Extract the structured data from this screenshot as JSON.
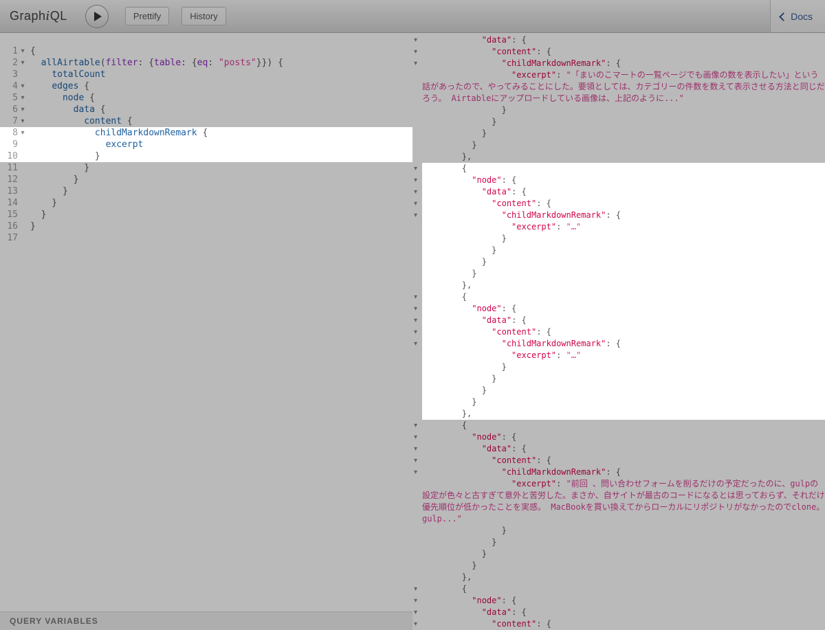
{
  "topbar": {
    "logo": {
      "part1": "Graph",
      "part2": "i",
      "part3": "QL"
    },
    "prettify_label": "Prettify",
    "history_label": "History",
    "docs_label": "Docs"
  },
  "icons": {
    "execute_icon": "play-triangle",
    "fold_glyph": "▾",
    "docs_chevron_icon": "chevron-left"
  },
  "colors": {
    "docs_accent": "#3B5998",
    "field_name": "#1F61A0",
    "argument_name": "#8B2BB9",
    "string_value": "#D64292",
    "result_key": "#D2054E",
    "punctuation": "#555555",
    "dim_overlay": "rgba(0,0,0,0.27)"
  },
  "variables": {
    "title": "QUERY VARIABLES"
  },
  "editor": {
    "highlight": {
      "from": 8,
      "to": 10
    },
    "lines": [
      {
        "n": 1,
        "fold": true,
        "toks": [
          [
            "p",
            "{"
          ]
        ]
      },
      {
        "n": 2,
        "fold": true,
        "toks": [
          [
            "p",
            "  "
          ],
          [
            "prop",
            "allAirtable"
          ],
          [
            "p",
            "("
          ],
          [
            "attr",
            "filter"
          ],
          [
            "p",
            ": {"
          ],
          [
            "attr",
            "table"
          ],
          [
            "p",
            ": {"
          ],
          [
            "attr",
            "eq"
          ],
          [
            "p",
            ": "
          ],
          [
            "s",
            "\"posts\""
          ],
          [
            "p",
            "}}) {"
          ]
        ]
      },
      {
        "n": 3,
        "fold": false,
        "toks": [
          [
            "p",
            "    "
          ],
          [
            "prop",
            "totalCount"
          ]
        ]
      },
      {
        "n": 4,
        "fold": true,
        "toks": [
          [
            "p",
            "    "
          ],
          [
            "prop",
            "edges"
          ],
          [
            "p",
            " {"
          ]
        ]
      },
      {
        "n": 5,
        "fold": true,
        "toks": [
          [
            "p",
            "      "
          ],
          [
            "prop",
            "node"
          ],
          [
            "p",
            " {"
          ]
        ]
      },
      {
        "n": 6,
        "fold": true,
        "toks": [
          [
            "p",
            "        "
          ],
          [
            "prop",
            "data"
          ],
          [
            "p",
            " {"
          ]
        ]
      },
      {
        "n": 7,
        "fold": true,
        "toks": [
          [
            "p",
            "          "
          ],
          [
            "prop",
            "content"
          ],
          [
            "p",
            " {"
          ]
        ]
      },
      {
        "n": 8,
        "fold": true,
        "toks": [
          [
            "p",
            "            "
          ],
          [
            "prop",
            "childMarkdownRemark"
          ],
          [
            "p",
            " {"
          ]
        ]
      },
      {
        "n": 9,
        "fold": false,
        "toks": [
          [
            "p",
            "              "
          ],
          [
            "prop",
            "excerpt"
          ]
        ]
      },
      {
        "n": 10,
        "fold": false,
        "toks": [
          [
            "p",
            "            }"
          ]
        ]
      },
      {
        "n": 11,
        "fold": false,
        "toks": [
          [
            "p",
            "          }"
          ]
        ]
      },
      {
        "n": 12,
        "fold": false,
        "toks": [
          [
            "p",
            "        }"
          ]
        ]
      },
      {
        "n": 13,
        "fold": false,
        "toks": [
          [
            "p",
            "      }"
          ]
        ]
      },
      {
        "n": 14,
        "fold": false,
        "toks": [
          [
            "p",
            "    }"
          ]
        ]
      },
      {
        "n": 15,
        "fold": false,
        "toks": [
          [
            "p",
            "  }"
          ]
        ]
      },
      {
        "n": 16,
        "fold": false,
        "toks": [
          [
            "p",
            "}"
          ]
        ]
      },
      {
        "n": 17,
        "fold": false,
        "toks": []
      }
    ]
  },
  "result": {
    "highlight": {
      "from": 10,
      "to": 31
    },
    "lines": [
      {
        "ind": 12,
        "fold": true,
        "toks": [
          [
            "k",
            "\"data\""
          ],
          [
            "p",
            ": {"
          ]
        ]
      },
      {
        "ind": 14,
        "fold": true,
        "toks": [
          [
            "k",
            "\"content\""
          ],
          [
            "p",
            ": {"
          ]
        ]
      },
      {
        "ind": 16,
        "fold": true,
        "toks": [
          [
            "k",
            "\"childMarkdownRemark\""
          ],
          [
            "p",
            ": {"
          ]
        ]
      },
      {
        "ind": 18,
        "fold": false,
        "toks": [
          [
            "k",
            "\"excerpt\""
          ],
          [
            "p",
            ": "
          ],
          [
            "s",
            "\"「まいのこマートの一覧ページでも画像の数を表示したい」という話があったので、やってみることにした。要領としては、カテゴリーの件数を数えて表示させる方法と同じだろう。 Airtableにアップロードしている画像は、上記のように...\""
          ]
        ]
      },
      {
        "ind": 16,
        "fold": false,
        "toks": [
          [
            "p",
            "}"
          ]
        ]
      },
      {
        "ind": 14,
        "fold": false,
        "toks": [
          [
            "p",
            "}"
          ]
        ]
      },
      {
        "ind": 12,
        "fold": false,
        "toks": [
          [
            "p",
            "}"
          ]
        ]
      },
      {
        "ind": 10,
        "fold": false,
        "toks": [
          [
            "p",
            "}"
          ]
        ]
      },
      {
        "ind": 8,
        "fold": false,
        "toks": [
          [
            "p",
            "},"
          ]
        ]
      },
      {
        "ind": 8,
        "fold": true,
        "toks": [
          [
            "p",
            "{"
          ]
        ]
      },
      {
        "ind": 10,
        "fold": true,
        "toks": [
          [
            "k",
            "\"node\""
          ],
          [
            "p",
            ": {"
          ]
        ]
      },
      {
        "ind": 12,
        "fold": true,
        "toks": [
          [
            "k",
            "\"data\""
          ],
          [
            "p",
            ": {"
          ]
        ]
      },
      {
        "ind": 14,
        "fold": true,
        "toks": [
          [
            "k",
            "\"content\""
          ],
          [
            "p",
            ": {"
          ]
        ]
      },
      {
        "ind": 16,
        "fold": true,
        "toks": [
          [
            "k",
            "\"childMarkdownRemark\""
          ],
          [
            "p",
            ": {"
          ]
        ]
      },
      {
        "ind": 18,
        "fold": false,
        "toks": [
          [
            "k",
            "\"excerpt\""
          ],
          [
            "p",
            ": "
          ],
          [
            "s",
            "\"…\""
          ]
        ]
      },
      {
        "ind": 16,
        "fold": false,
        "toks": [
          [
            "p",
            "}"
          ]
        ]
      },
      {
        "ind": 14,
        "fold": false,
        "toks": [
          [
            "p",
            "}"
          ]
        ]
      },
      {
        "ind": 12,
        "fold": false,
        "toks": [
          [
            "p",
            "}"
          ]
        ]
      },
      {
        "ind": 10,
        "fold": false,
        "toks": [
          [
            "p",
            "}"
          ]
        ]
      },
      {
        "ind": 8,
        "fold": false,
        "toks": [
          [
            "p",
            "},"
          ]
        ]
      },
      {
        "ind": 8,
        "fold": true,
        "toks": [
          [
            "p",
            "{"
          ]
        ]
      },
      {
        "ind": 10,
        "fold": true,
        "toks": [
          [
            "k",
            "\"node\""
          ],
          [
            "p",
            ": {"
          ]
        ]
      },
      {
        "ind": 12,
        "fold": true,
        "toks": [
          [
            "k",
            "\"data\""
          ],
          [
            "p",
            ": {"
          ]
        ]
      },
      {
        "ind": 14,
        "fold": true,
        "toks": [
          [
            "k",
            "\"content\""
          ],
          [
            "p",
            ": {"
          ]
        ]
      },
      {
        "ind": 16,
        "fold": true,
        "toks": [
          [
            "k",
            "\"childMarkdownRemark\""
          ],
          [
            "p",
            ": {"
          ]
        ]
      },
      {
        "ind": 18,
        "fold": false,
        "toks": [
          [
            "k",
            "\"excerpt\""
          ],
          [
            "p",
            ": "
          ],
          [
            "s",
            "\"…\""
          ]
        ]
      },
      {
        "ind": 16,
        "fold": false,
        "toks": [
          [
            "p",
            "}"
          ]
        ]
      },
      {
        "ind": 14,
        "fold": false,
        "toks": [
          [
            "p",
            "}"
          ]
        ]
      },
      {
        "ind": 12,
        "fold": false,
        "toks": [
          [
            "p",
            "}"
          ]
        ]
      },
      {
        "ind": 10,
        "fold": false,
        "toks": [
          [
            "p",
            "}"
          ]
        ]
      },
      {
        "ind": 8,
        "fold": false,
        "toks": [
          [
            "p",
            "},"
          ]
        ]
      },
      {
        "ind": 8,
        "fold": true,
        "toks": [
          [
            "p",
            "{"
          ]
        ]
      },
      {
        "ind": 10,
        "fold": true,
        "toks": [
          [
            "k",
            "\"node\""
          ],
          [
            "p",
            ": {"
          ]
        ]
      },
      {
        "ind": 12,
        "fold": true,
        "toks": [
          [
            "k",
            "\"data\""
          ],
          [
            "p",
            ": {"
          ]
        ]
      },
      {
        "ind": 14,
        "fold": true,
        "toks": [
          [
            "k",
            "\"content\""
          ],
          [
            "p",
            ": {"
          ]
        ]
      },
      {
        "ind": 16,
        "fold": true,
        "toks": [
          [
            "k",
            "\"childMarkdownRemark\""
          ],
          [
            "p",
            ": {"
          ]
        ]
      },
      {
        "ind": 18,
        "fold": false,
        "toks": [
          [
            "k",
            "\"excerpt\""
          ],
          [
            "p",
            ": "
          ],
          [
            "s",
            "\"前回 、問い合わせフォームを削るだけの予定だったのに、gulpの設定が色々と古すぎて意外と苦労した。まさか、自サイトが最古のコードになるとは思っておらず、それだけ優先順位が低かったことを実感。 MacBookを買い換えてからローカルにリポジトリがなかったのでclone。gulp...\""
          ]
        ]
      },
      {
        "ind": 16,
        "fold": false,
        "toks": [
          [
            "p",
            "}"
          ]
        ]
      },
      {
        "ind": 14,
        "fold": false,
        "toks": [
          [
            "p",
            "}"
          ]
        ]
      },
      {
        "ind": 12,
        "fold": false,
        "toks": [
          [
            "p",
            "}"
          ]
        ]
      },
      {
        "ind": 10,
        "fold": false,
        "toks": [
          [
            "p",
            "}"
          ]
        ]
      },
      {
        "ind": 8,
        "fold": false,
        "toks": [
          [
            "p",
            "},"
          ]
        ]
      },
      {
        "ind": 8,
        "fold": true,
        "toks": [
          [
            "p",
            "{"
          ]
        ]
      },
      {
        "ind": 10,
        "fold": true,
        "toks": [
          [
            "k",
            "\"node\""
          ],
          [
            "p",
            ": {"
          ]
        ]
      },
      {
        "ind": 12,
        "fold": true,
        "toks": [
          [
            "k",
            "\"data\""
          ],
          [
            "p",
            ": {"
          ]
        ]
      },
      {
        "ind": 14,
        "fold": true,
        "toks": [
          [
            "k",
            "\"content\""
          ],
          [
            "p",
            ": {"
          ]
        ]
      }
    ]
  }
}
